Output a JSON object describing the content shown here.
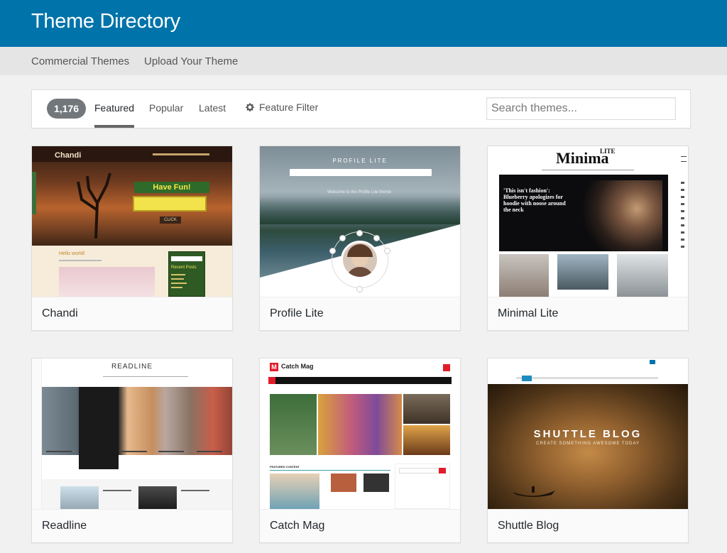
{
  "header": {
    "title": "Theme Directory"
  },
  "subnav": {
    "items": [
      "Commercial Themes",
      "Upload Your Theme"
    ]
  },
  "filter": {
    "count": "1,176",
    "tabs": [
      "Featured",
      "Popular",
      "Latest"
    ],
    "feature_filter_label": "Feature Filter",
    "search_placeholder": "Search themes..."
  },
  "themes": [
    {
      "name": "Chandi",
      "logo": "Chandi",
      "banner": "Have Fun!",
      "button": "CLICK",
      "post_title": "Hello world!",
      "widget_title": "Recent Posts"
    },
    {
      "name": "Profile Lite",
      "logo": "PROFILE LITE",
      "tagline": "Welcome to the Profile Lite theme"
    },
    {
      "name": "Minimal Lite",
      "logo": "Minima",
      "logo_sup": "LITE",
      "headline": "'This isn't fashion': Blueberry apologizes for hoodie with noose around the neck"
    },
    {
      "name": "Readline",
      "logo": "READLINE"
    },
    {
      "name": "Catch Mag",
      "logo": "Catch Mag",
      "section": "FEATURED CONTENT"
    },
    {
      "name": "Shuttle Blog",
      "logo": "SHUTTLE BLOG",
      "tagline": "CREATE SOMETHING AWESOME TODAY"
    }
  ],
  "colors": {
    "header": "#0073aa",
    "count_badge": "#72777c"
  }
}
